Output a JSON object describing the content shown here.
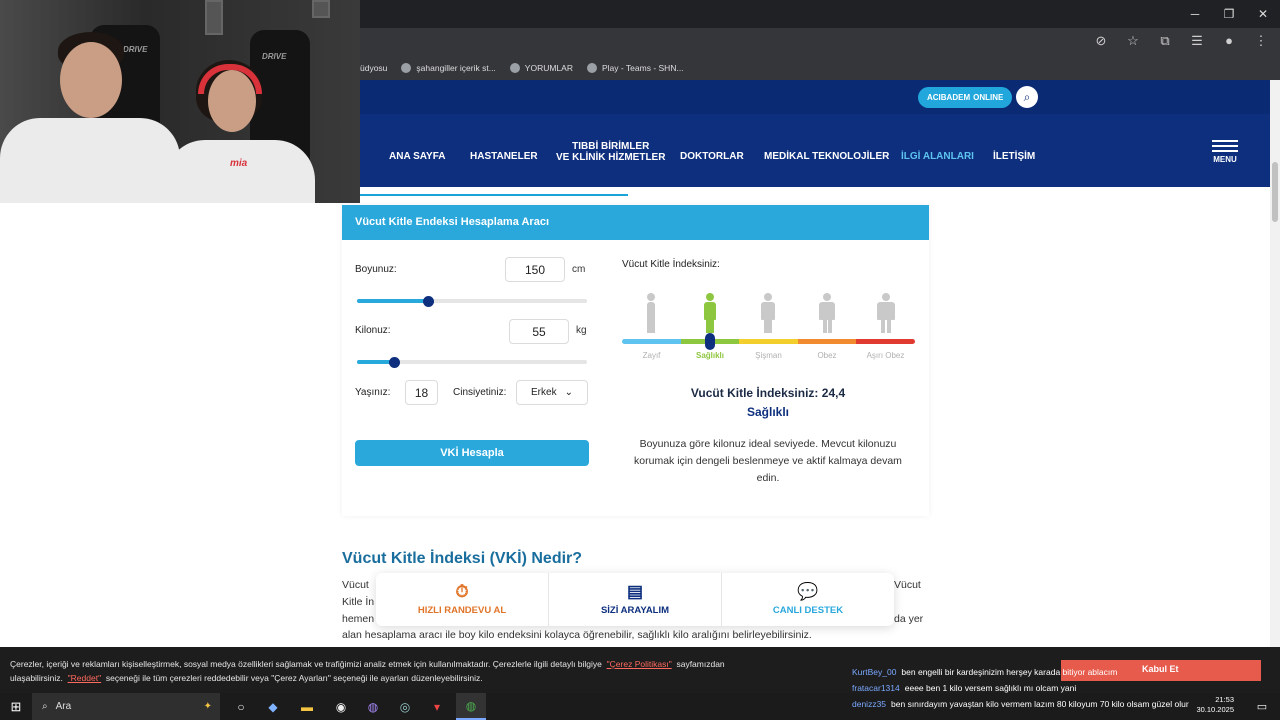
{
  "window_controls": {
    "minimize": "─",
    "maximize": "❐",
    "close": "✕"
  },
  "bookmarks": [
    {
      "label": "üdyosu"
    },
    {
      "label": "şahangiller içerik st..."
    },
    {
      "label": "YORUMLAR"
    },
    {
      "label": "Play - Teams - SHN..."
    }
  ],
  "header": {
    "online_badge_brand": "ACIBADEM",
    "online_badge_suffix": "ONLINE",
    "menu_label": "MENU"
  },
  "nav": {
    "items": [
      {
        "label": "ANA SAYFA"
      },
      {
        "label": "HASTANELER"
      },
      {
        "label_line1": "TIBBİ BİRİMLER",
        "label_line2": "VE KLİNİK HİZMETLER"
      },
      {
        "label": "DOKTORLAR"
      },
      {
        "label": "MEDİKAL TEKNOLOJİLER"
      },
      {
        "label": "İLGİ ALANLARI"
      },
      {
        "label": "İLETİŞİM"
      }
    ],
    "active_item": "İLGİ ALANLARI"
  },
  "webcam": {
    "chair_brand": "DRIVE",
    "chair_brand_left": "DRIVE",
    "shirt_text": "mia"
  },
  "calculator": {
    "title": "Vücut Kitle Endeksi Hesaplama Aracı",
    "height_label": "Boyunuz:",
    "height_value": "150",
    "height_unit": "cm",
    "height_slider_fraction": 0.31,
    "weight_label": "Kilonuz:",
    "weight_value": "55",
    "weight_unit": "kg",
    "weight_slider_fraction": 0.16,
    "age_label": "Yaşınız:",
    "age_value": "18",
    "gender_label": "Cinsiyetiniz:",
    "gender_value": "Erkek",
    "submit_label": "VKİ Hesapla"
  },
  "result": {
    "heading": "Vücut Kitle İndeksiniz:",
    "categories": [
      {
        "label": "Zayıf",
        "color": "#5ec3ef"
      },
      {
        "label": "Sağlıklı",
        "color": "#8dc63f"
      },
      {
        "label": "Şişman",
        "color": "#f2cf2c"
      },
      {
        "label": "Obez",
        "color": "#f28b30"
      },
      {
        "label": "Aşırı Obez",
        "color": "#e03a31"
      }
    ],
    "active_category": "Sağlıklı",
    "value_text": "Vucüt Kitle İndeksiniz: 24,4",
    "status": "Sağlıklı",
    "description": "Boyunuza göre kilonuz ideal seviyede. Mevcut kilonuzu korumak için dengeli beslenmeye ve aktif kalmaya devam edin."
  },
  "article": {
    "title": "Vücut Kitle İndeksi (VKİ) Nedir?",
    "line1_start": "Vücut",
    "line1_end": "Vücut",
    "line2_start": "Kitle İn",
    "line3_start": "hemen",
    "line3_end": "da yer",
    "line4": "alan hesaplama aracı ile boy kilo endeksini kolayca öğrenebilir, sağlıklı kilo aralığını belirleyebilirsiniz."
  },
  "actions": [
    {
      "label": "HIZLI RANDEVU AL",
      "color": "#e0752a",
      "icon": "stopwatch-icon"
    },
    {
      "label": "SİZİ ARAYALIM",
      "color": "#0d2f7e",
      "icon": "form-icon"
    },
    {
      "label": "CANLI DESTEK",
      "color": "#2aa8dc",
      "icon": "chat-icon"
    }
  ],
  "cookie": {
    "line1_text": "Çerezler, içeriği ve reklamları kişiselleştirmek, sosyal medya özellikleri sağlamak ve trafiğimizi analiz etmek için kullanılmaktadır. Çerezlerle ilgili detaylı bilgiye",
    "policy_link": "\"Çerez Politikası\"",
    "line1_end": "sayfamızdan",
    "line2_start": "ulaşabilirsiniz.",
    "reject_link": "\"Reddet\"",
    "line2_end": "seçeneği ile tüm çerezleri reddedebilir veya \"Çerez Ayarları\" seçeneği ile ayarları düzenleyebilirsiniz.",
    "accept_label": "Kabul Et"
  },
  "chat": [
    {
      "user": "KurtBey_00",
      "message": "ben engelli bir kardeşinizim herşey karada bitiyor ablacım"
    },
    {
      "user": "fratacar1314",
      "message": "eeee ben 1 kilo versem sağlıklı mı olcam yani"
    },
    {
      "user": "denizz35",
      "message": "ben sınırdayım yavaştan kilo vermem lazım 80 kiloyum 70 kilo olsam güzel olur"
    }
  ],
  "taskbar": {
    "search_placeholder": "Ara",
    "time": "21:53",
    "date": "30.10.2025"
  }
}
